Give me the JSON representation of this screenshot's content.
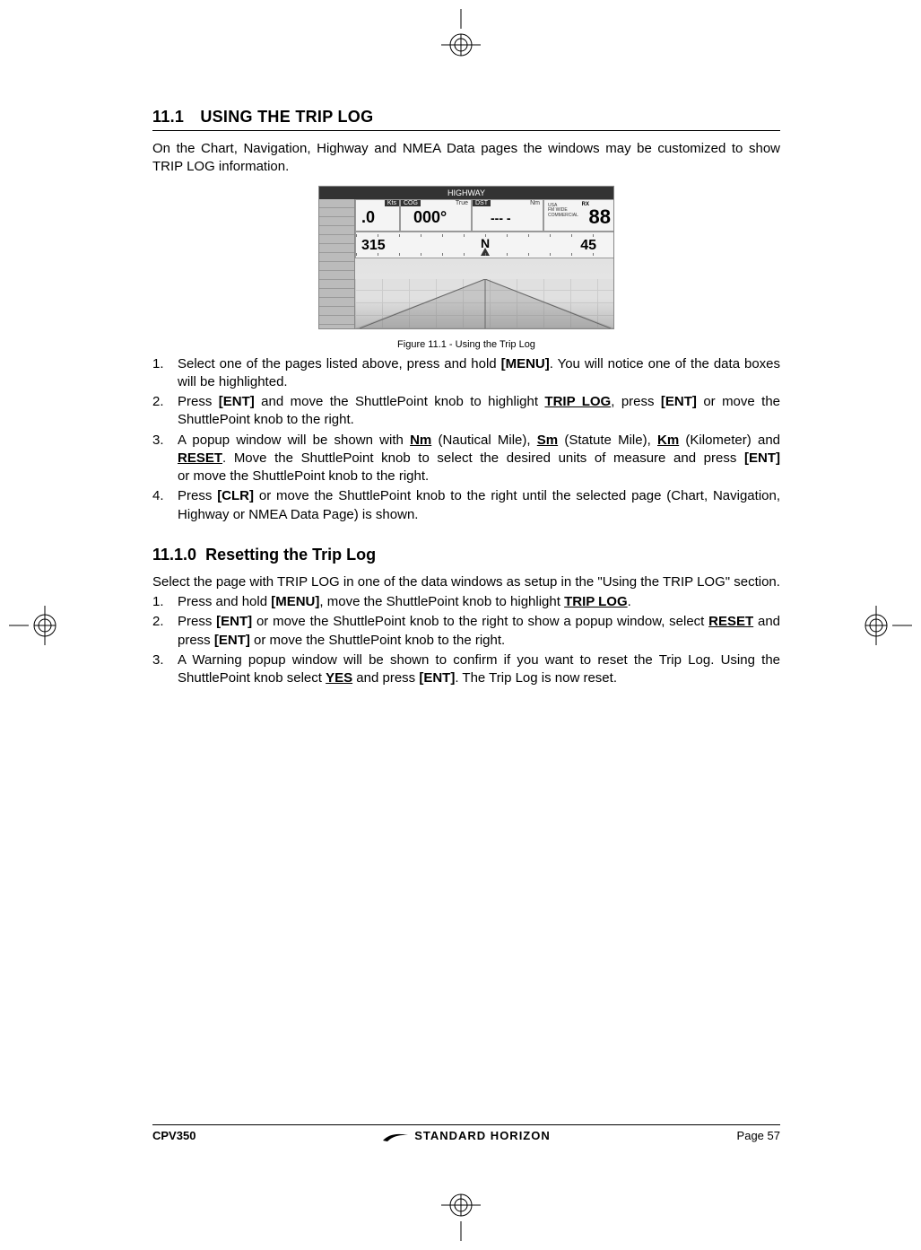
{
  "section": {
    "number": "11.1",
    "title": "USING THE TRIP LOG"
  },
  "intro": "On the Chart, Navigation, Highway and NMEA Data pages the windows may be customized to show TRIP LOG information.",
  "figure": {
    "header": "HIGHWAY",
    "cells": {
      "sog_label": "Kts",
      "sog_value": ".0",
      "cog_label": "COG",
      "cog_unit": "True",
      "cog_value": "000°",
      "dst_label": "DST",
      "dst_unit": "Nm",
      "dst_value": "--- -",
      "ch_small1": "USA",
      "ch_small2": "FM WIDE",
      "ch_small3": "COMMERCIAL",
      "ch_ind": "RX",
      "ch_value": "88",
      "left_value": "315",
      "right_value": "45",
      "compass": "N"
    },
    "caption": "Figure 11.1 -  Using the Trip Log"
  },
  "steps1": {
    "s1a": "Select one of the pages listed above, press and hold ",
    "s1b": "[MENU]",
    "s1c": ". You will notice one of the data boxes will be highlighted.",
    "s2a": "Press ",
    "s2b": "[ENT]",
    "s2c": " and move the ShuttlePoint knob to highlight  ",
    "s2d": "TRIP LOG",
    "s2e": ", press ",
    "s2f": "[ENT]",
    "s2g": " or move the ShuttlePoint knob to the right.",
    "s3a": "A popup window will be shown with ",
    "s3b": "Nm",
    "s3c": " (Nautical Mile), ",
    "s3d": "Sm",
    "s3e": " (Statute Mile), ",
    "s3f": "Km",
    "s3g": " (Kilometer) and ",
    "s3h": "RESET",
    "s3i": ". Move the ShuttlePoint knob to select the desired units of measure and press ",
    "s3j": "[ENT]",
    "s3k": " or move the ShuttlePoint knob to the right.",
    "s4a": "Press ",
    "s4b": "[CLR]",
    "s4c": " or move the ShuttlePoint knob to the right until the selected page (Chart, Navigation, Highway or NMEA Data Page) is shown."
  },
  "subsection": {
    "number": "11.1.0",
    "title": "Resetting the Trip Log"
  },
  "intro2": "Select the page with TRIP LOG in one of the data windows as setup in the \"Using the TRIP LOG\" section.",
  "steps2": {
    "s1a": "Press and hold ",
    "s1b": "[MENU]",
    "s1c": ", move the ShuttlePoint knob to highlight ",
    "s1d": "TRIP LOG",
    "s1e": ".",
    "s2a": "Press ",
    "s2b": "[ENT]",
    "s2c": " or move the ShuttlePoint knob to the right to show a popup window, select ",
    "s2d": "RESET",
    "s2e": " and press ",
    "s2f": "[ENT]",
    "s2g": " or move the ShuttlePoint knob to the right.",
    "s3a": "A Warning popup window will be shown to confirm if you want to reset the Trip Log. Using the ShuttlePoint knob select ",
    "s3b": "YES",
    "s3c": " and press ",
    "s3d": "[ENT]",
    "s3e": ". The Trip Log is now reset."
  },
  "footer": {
    "model": "CPV350",
    "brand": "STANDARD HORIZON",
    "page": "Page 57"
  }
}
